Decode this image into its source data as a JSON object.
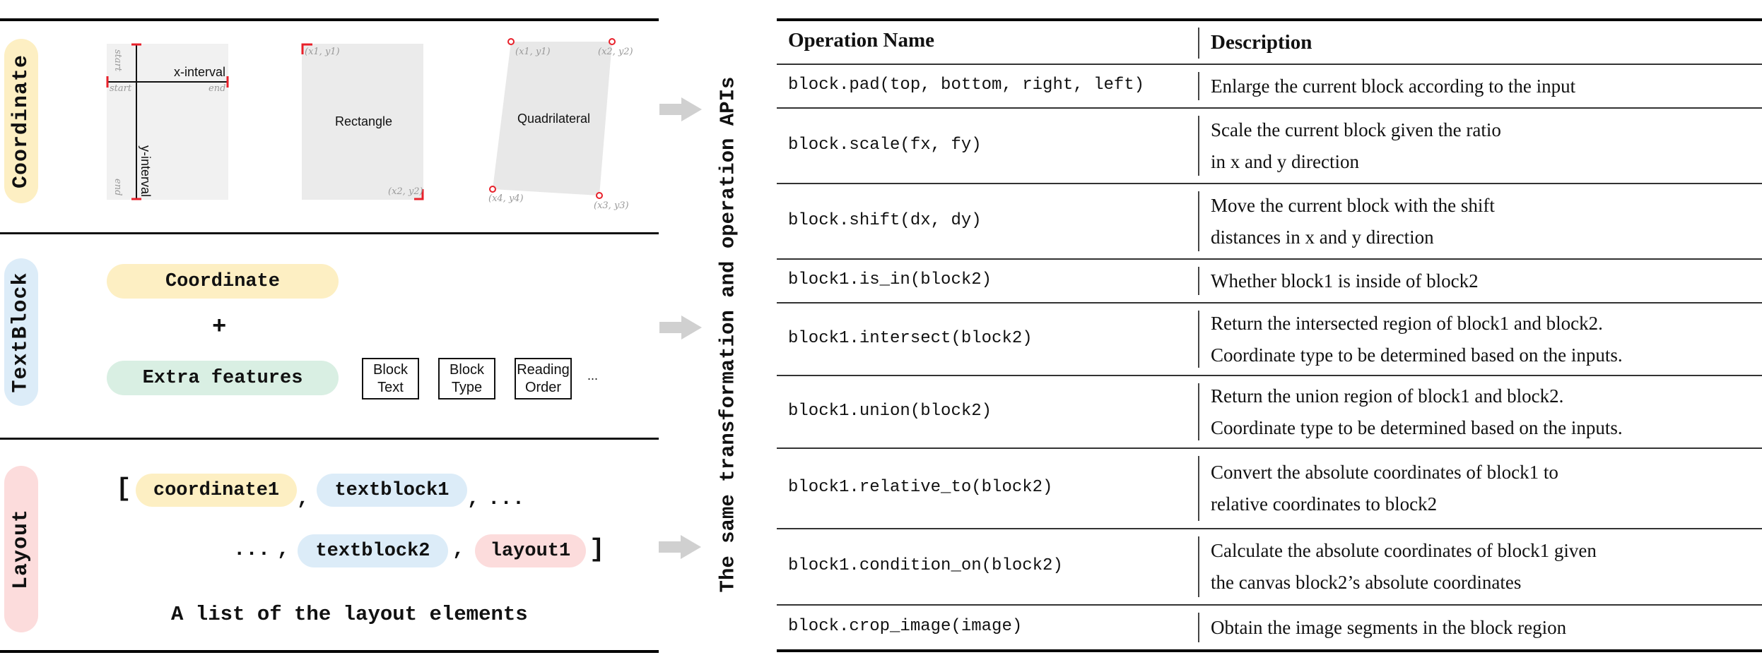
{
  "sections": {
    "coordinate": {
      "label": "Coordinate",
      "color": "#fdefc3",
      "interval": {
        "x_label": "x-interval",
        "y_label": "y-interval",
        "x_start": "start",
        "x_end": "end",
        "y_start": "start",
        "y_end": "end"
      },
      "rectangle": {
        "label": "Rectangle",
        "p1": "(x1, y1)",
        "p2": "(x2, y2)"
      },
      "quadrilateral": {
        "label": "Quadrilateral",
        "p1": "(x1, y1)",
        "p2": "(x2, y2)",
        "p3": "(x3, y3)",
        "p4": "(x4, y4)"
      }
    },
    "textblock": {
      "label": "TextBlock",
      "color": "#dcecf8",
      "coordinate_pill": "Coordinate",
      "plus": "+",
      "extra_pill": "Extra features",
      "extra_color": "#d9efe3",
      "features": [
        {
          "line1": "Block",
          "line2": "Text"
        },
        {
          "line1": "Block",
          "line2": "Type"
        },
        {
          "line1": "Reading",
          "line2": "Order"
        }
      ],
      "ellipsis": "..."
    },
    "layout": {
      "label": "Layout",
      "color": "#fcdcdc",
      "open_bracket": "[",
      "close_bracket": "]",
      "items_row1": [
        "coordinate1",
        "textblock1"
      ],
      "items_row2": [
        "textblock2",
        "layout1"
      ],
      "comma": ",",
      "trail_ellipsis": "...",
      "lead_ellipsis": "...",
      "caption": "A list of the layout elements"
    }
  },
  "caption_vertical": "The same transformation and operation APIs",
  "table": {
    "headers": [
      "Operation Name",
      "Description"
    ],
    "rows": [
      {
        "op": "block.pad(top, bottom, right, left)",
        "desc": [
          "Enlarge the current block according to the input"
        ]
      },
      {
        "op": "block.scale(fx, fy)",
        "desc": [
          "Scale the current block given the ratio",
          "in x and y direction"
        ]
      },
      {
        "op": "block.shift(dx, dy)",
        "desc": [
          "Move the current block with the shift",
          "distances in x and y direction"
        ]
      },
      {
        "op": "block1.is_in(block2)",
        "desc": [
          "Whether block1 is inside of block2"
        ]
      },
      {
        "op": "block1.intersect(block2)",
        "desc": [
          "Return the intersected region of block1 and block2.",
          "Coordinate type to be determined based on the inputs."
        ]
      },
      {
        "op": "block1.union(block2)",
        "desc": [
          "Return the union region of block1 and block2.",
          "Coordinate type to be determined based on the inputs."
        ]
      },
      {
        "op": "block1.relative_to(block2)",
        "desc": [
          "Convert the absolute coordinates of block1 to",
          "relative coordinates to block2"
        ]
      },
      {
        "op": "block1.condition_on(block2)",
        "desc": [
          "Calculate the absolute coordinates of block1 given",
          "the canvas block2’s absolute coordinates"
        ]
      },
      {
        "op": "block.crop_image(image)",
        "desc": [
          "Obtain the image segments in the block region"
        ]
      }
    ]
  },
  "colors": {
    "marker_red": "#e8202a",
    "arrow_gray": "#d0d0d0"
  }
}
